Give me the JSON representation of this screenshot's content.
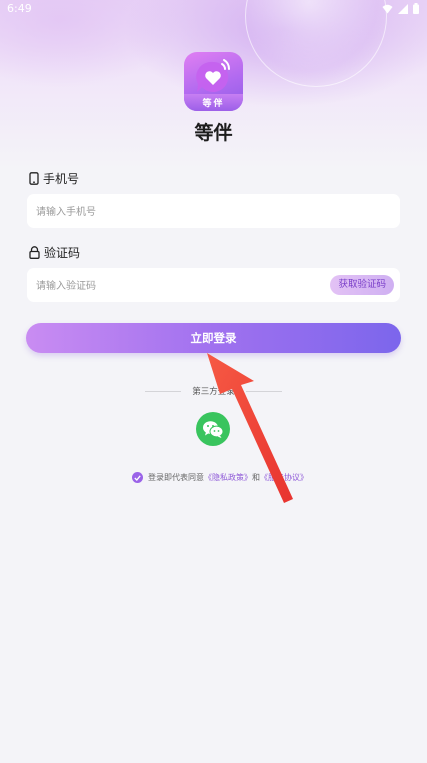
{
  "status_bar": {
    "time": "6:49"
  },
  "app": {
    "logo_text": "等伴",
    "name": "等伴"
  },
  "phone": {
    "label": "手机号",
    "placeholder": "请输入手机号",
    "value": ""
  },
  "code": {
    "label": "验证码",
    "placeholder": "请输入验证码",
    "value": "",
    "button": "获取验证码"
  },
  "login_button": "立即登录",
  "third_party": {
    "label": "第三方登录"
  },
  "agreement": {
    "prefix": "登录即代表同意",
    "privacy": "《隐私政策》",
    "and": "和",
    "service": "《服务协议》",
    "checked": true
  },
  "colors": {
    "accent": "#9a63e8",
    "wechat": "#39c45e",
    "arrow": "#f2413a"
  },
  "icons": [
    "wifi-icon",
    "signal-icon",
    "battery-icon",
    "phone-icon",
    "lock-icon",
    "wechat-icon",
    "check-icon"
  ]
}
